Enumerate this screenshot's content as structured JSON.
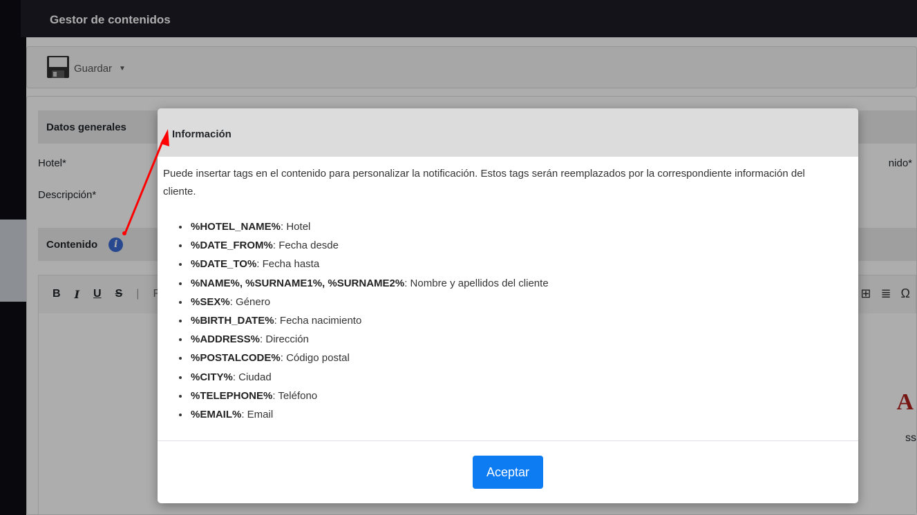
{
  "app": {
    "title": "Gestor de contenidos",
    "toolbar": {
      "save_label": "Guardar"
    },
    "general_section": {
      "title": "Datos generales",
      "hotel_label": "Hotel*",
      "description_label": "Descripción*",
      "content_name_label_partial": "nido*"
    },
    "content_section": {
      "title": "Contenido",
      "info_icon_glyph": "i"
    },
    "editor": {
      "toolbar_buttons": [
        "B",
        "I",
        "U",
        "S"
      ],
      "partial_label": "F",
      "right_glyphs": [
        "⊞",
        "≣",
        "Ω"
      ],
      "preview_letter": "A",
      "preview_text": "ss"
    }
  },
  "modal": {
    "title": "Información",
    "intro": "Puede insertar tags en el contenido para personalizar la notificación. Estos tags serán reemplazados por la correspondiente información del cliente.",
    "tags": [
      {
        "tag": "%HOTEL_NAME%",
        "desc": ": Hotel"
      },
      {
        "tag": "%DATE_FROM%",
        "desc": ": Fecha desde"
      },
      {
        "tag": "%DATE_TO%",
        "desc": ": Fecha hasta"
      },
      {
        "tag": "%NAME%, %SURNAME1%, %SURNAME2%",
        "desc": ": Nombre y apellidos del cliente"
      },
      {
        "tag": "%SEX%",
        "desc": ": Género"
      },
      {
        "tag": "%BIRTH_DATE%",
        "desc": ": Fecha nacimiento"
      },
      {
        "tag": "%ADDRESS%",
        "desc": ": Dirección"
      },
      {
        "tag": "%POSTALCODE%",
        "desc": ": Código postal"
      },
      {
        "tag": "%CITY%",
        "desc": ": Ciudad"
      },
      {
        "tag": "%TELEPHONE%",
        "desc": ": Teléfono"
      },
      {
        "tag": "%EMAIL%",
        "desc": ": Email"
      }
    ],
    "accept_label": "Aceptar"
  },
  "colors": {
    "accent": "#0d7cf2",
    "annotation_arrow": "#ff0000",
    "info_icon": "#3b6cd4",
    "topbar": "#1c1d26"
  }
}
